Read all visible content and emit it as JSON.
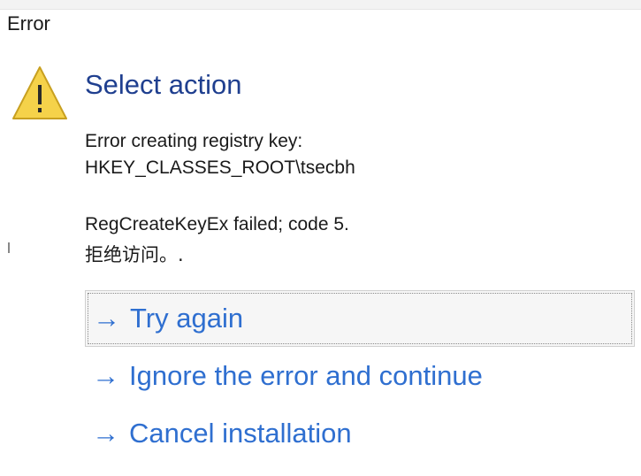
{
  "window": {
    "title": "Error"
  },
  "dialog": {
    "heading": "Select action",
    "icon": "warning-triangle-icon",
    "message_line1": "Error creating registry key:",
    "message_line2": "HKEY_CLASSES_ROOT\\tsecbh",
    "message_line3": "RegCreateKeyEx failed; code 5.",
    "message_line4": "拒绝访问。."
  },
  "actions": [
    {
      "arrow": "→",
      "label": "Try again"
    },
    {
      "arrow": "→",
      "label": "Ignore the error and continue"
    },
    {
      "arrow": "→",
      "label": "Cancel installation"
    }
  ],
  "colors": {
    "heading": "#1f3f8f",
    "action_link": "#2f6fd0",
    "warning_fill": "#f5d24a",
    "warning_border": "#c8a020"
  }
}
